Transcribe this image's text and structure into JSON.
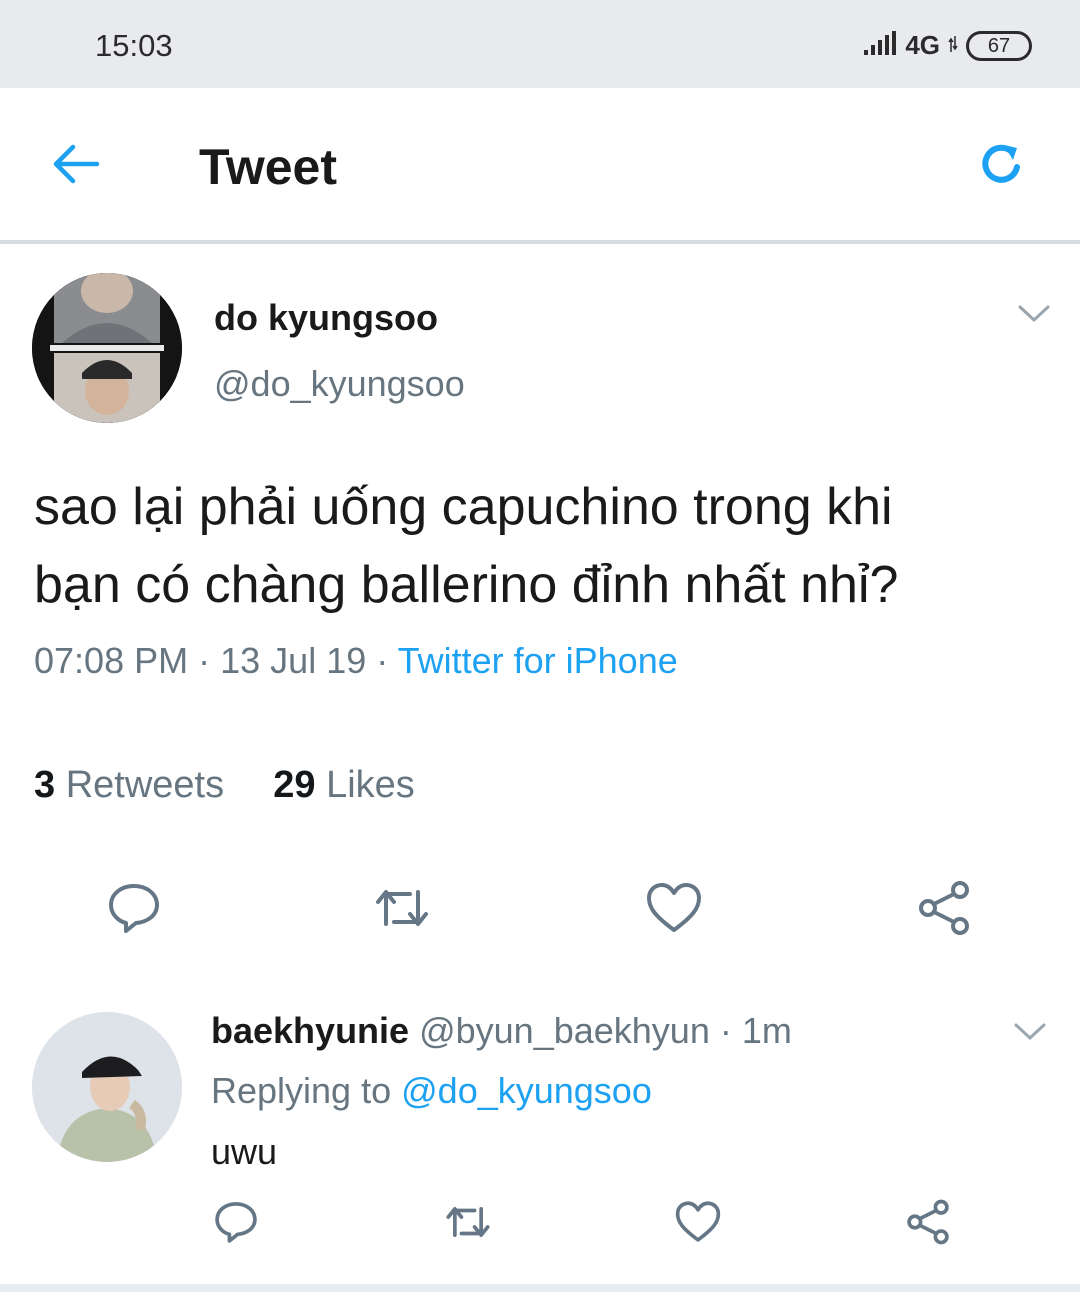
{
  "status_bar": {
    "time": "15:03",
    "network": "4G",
    "battery": "67"
  },
  "header": {
    "title": "Tweet"
  },
  "tweet": {
    "author_name": "do kyungsoo",
    "author_handle": "@do_kyungsoo",
    "text_line1": "sao lại phải uống capuchino trong khi",
    "text_line2": "bạn có chàng ballerino đỉnh nhất nhỉ?",
    "time": "07:08 PM",
    "date": "13 Jul 19",
    "separator": "·",
    "source": "Twitter for iPhone",
    "retweets_count": "3",
    "retweets_label": "Retweets",
    "likes_count": "29",
    "likes_label": "Likes"
  },
  "reply": {
    "author_name": "baekhyunie",
    "author_handle": "@byun_baekhyun",
    "time": "1m",
    "separator": "·",
    "replying_prefix": "Replying to",
    "replying_to": "@do_kyungsoo",
    "text": "uwu"
  },
  "icons": {
    "back": "arrow-left-icon",
    "refresh": "refresh-icon",
    "caret": "chevron-down-icon",
    "reply": "reply-icon",
    "retweet": "retweet-icon",
    "like": "heart-icon",
    "share": "share-icon"
  },
  "colors": {
    "accent": "#1da1f2",
    "muted": "#66757f",
    "text": "#14171a",
    "status_bar": "#e8eaee"
  }
}
